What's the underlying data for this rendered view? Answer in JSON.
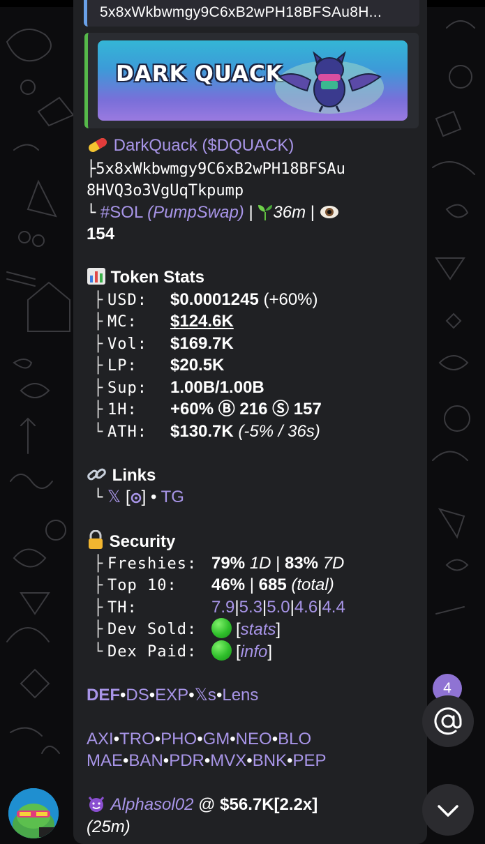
{
  "quoted_ca": "5x8xWkbwmgy9C6xB2wPH18BFSAu8H...",
  "banner": {
    "title": "DARK QUACK"
  },
  "token": {
    "name": "DarkQuack",
    "ticker": "($DQUACK)",
    "branch_top": "├",
    "ca_line1": "5x8xWkbwmgy9C6xB2wPH18BFSAu",
    "ca_line2": "8HVQ3o3VgUqTkpump",
    "branch_last": "└",
    "chain": "#SOL",
    "dex": "(PumpSwap)",
    "separator": "|",
    "age": "36m",
    "views": "154"
  },
  "stats": {
    "heading": "Token Stats",
    "rows": [
      {
        "branch": "├",
        "label": "USD:",
        "value": "$0.0001245",
        "extra": "(+60%)"
      },
      {
        "branch": "├",
        "label": "MC:",
        "value": "$124.6K"
      },
      {
        "branch": "├",
        "label": "Vol:",
        "value": "$169.7K"
      },
      {
        "branch": "├",
        "label": "LP:",
        "value": "$20.5K"
      },
      {
        "branch": "├",
        "label": "Sup:",
        "value": "1.00B/1.00B"
      },
      {
        "branch": "├",
        "label": "1H:",
        "value": "+60%",
        "buys": "216",
        "sells": "157",
        "buy_icon": "Ⓑ",
        "sell_icon": "Ⓢ"
      },
      {
        "branch": "└",
        "label": "ATH:",
        "value": "$130.7K",
        "extra": "(-5% / 36s)"
      }
    ]
  },
  "links": {
    "heading": "Links",
    "branch": "└",
    "x": "𝕏",
    "bracket_open": "[",
    "bracket_close": "]",
    "dot": "•",
    "tg": "TG"
  },
  "security": {
    "heading": "Security",
    "freshies": {
      "branch": "├",
      "label": "Freshies:",
      "v1": "79%",
      "p1": "1D",
      "sep": "|",
      "v2": "83%",
      "p2": "7D"
    },
    "top10": {
      "branch": "├",
      "label": "Top 10:",
      "v1": "46%",
      "sep": "|",
      "v2": "685",
      "p2": "(total)"
    },
    "th": {
      "branch": "├",
      "label": "TH:",
      "values": [
        "7.9",
        "5.3",
        "5.0",
        "4.6",
        "4.4"
      ],
      "sep": "|"
    },
    "dev_sold": {
      "branch": "├",
      "label": "Dev Sold:",
      "link": "stats"
    },
    "dex_paid": {
      "branch": "└",
      "label": "Dex Paid:",
      "link": "info"
    }
  },
  "tools_row": [
    "DEF",
    "DS",
    "EXP",
    "𝕏s",
    "Lens"
  ],
  "bots_row1": [
    "AXI",
    "TRO",
    "PHO",
    "GM",
    "NEO",
    "BLO"
  ],
  "bots_row2": [
    "MAE",
    "BAN",
    "PDR",
    "MVX",
    "BNK",
    "PEP"
  ],
  "bullet": "•",
  "caller": {
    "name": "Alphasol02",
    "at": "@",
    "mc": "$56.7K",
    "mult": "[2.2x]",
    "time": "(25m)"
  },
  "mentions": {
    "count": "4",
    "icon": "at-icon"
  },
  "colors": {
    "link": "#a895e8",
    "bubble": "#202124",
    "badge": "#8f73d3",
    "quote_bar": "#6aa1e8",
    "preview_bar": "#56b94a"
  }
}
